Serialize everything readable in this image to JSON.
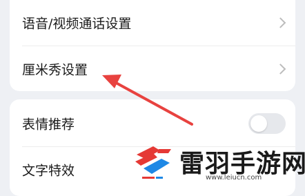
{
  "settings_group_1": {
    "items": [
      {
        "label": "语音/视频通话设置",
        "icon": "chevron-right-icon"
      },
      {
        "label": "厘米秀设置",
        "icon": "chevron-right-icon"
      }
    ]
  },
  "settings_group_2": {
    "items": [
      {
        "label": "表情推荐",
        "control": "toggle",
        "state": "off"
      },
      {
        "label": "文字特效"
      }
    ]
  },
  "annotation": {
    "arrow_color": "#e8423f"
  },
  "watermark": {
    "site_name": "雷羽手游网",
    "url": "www.leiucn.com",
    "brand_colors": [
      "#e53935",
      "#1e88e5"
    ]
  }
}
